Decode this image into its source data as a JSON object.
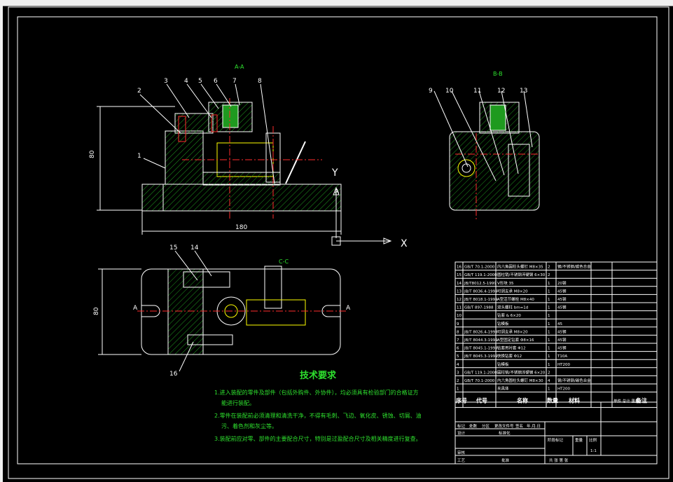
{
  "drawing": {
    "balloons": [
      "1",
      "2",
      "3",
      "4",
      "5",
      "6",
      "7",
      "8",
      "9",
      "10",
      "11",
      "12",
      "13",
      "14",
      "15",
      "16"
    ],
    "section_labels": {
      "aa": "A-A",
      "bb": "B-B",
      "cc": "C-C",
      "a": "A",
      "b": "B"
    },
    "axis_labels": {
      "y": "Y",
      "x": "X"
    },
    "dimensions": {
      "height1": "80",
      "width1": "180",
      "height2": "80"
    }
  },
  "tech": {
    "title": "技术要求",
    "lines": [
      "1.进入装配的零件及部件（包括外购件、外协件），均必须具有检验部门的合格证方",
      "能进行装配。",
      "2.零件在装配前必须清理和清洗干净，不得有毛刺、飞边、氧化皮、锈蚀、切屑、油",
      "污、着色剂和灰尘等。",
      "3.装配前应对零、部件的主要配合尺寸，特别是过盈配合尺寸及相关精度进行复查。"
    ]
  },
  "bom": {
    "rows": [
      [
        "16",
        "GB/T 70.1-2000",
        "内六角圆柱头螺钉 M8×35",
        "2",
        "钢/不锈钢/碳色合金",
        ""
      ],
      [
        "15",
        "GB/T 119.1-2000",
        "圆柱销/不锈钢淬硬钢 6×30",
        "2",
        "",
        ""
      ],
      [
        "14",
        "JB/T8012.5-1999",
        "V形块 35",
        "1",
        "20钢",
        ""
      ],
      [
        "13",
        "JB/T 8036.4-1999",
        "可调支承 M8×20",
        "1",
        "45钢",
        ""
      ],
      [
        "12",
        "JB/T 8018.1-1999",
        "A型活节螺栓 M8×40",
        "1",
        "45钢",
        ""
      ],
      [
        "11",
        "GB/T 897-1988",
        "双头螺柱 bm=1d",
        "1",
        "45钢",
        ""
      ],
      [
        "10",
        "",
        "钻套 & 6×20",
        "1",
        "",
        ""
      ],
      [
        "9",
        "",
        "钻模板",
        "1",
        "45",
        ""
      ],
      [
        "8",
        "JB/T 8026.4-1999",
        "可调支承 M8×20",
        "1",
        "45钢",
        ""
      ],
      [
        "7",
        "JB/T 8044.3-1999",
        "A型固定钻套 Φ8×16",
        "1",
        "45钢",
        ""
      ],
      [
        "6",
        "JB/T 8045.1-1999",
        "钻套用衬套 Φ12",
        "1",
        "45钢",
        ""
      ],
      [
        "5",
        "JB/T 8045.3-1999",
        "快换钻套 Φ12",
        "1",
        "T10A",
        ""
      ],
      [
        "4",
        "",
        "钻模板",
        "1",
        "HT200",
        ""
      ],
      [
        "3",
        "GB/T 119.1-2000",
        "圆柱销/不锈钢淬硬钢 6×20",
        "2",
        "",
        ""
      ],
      [
        "2",
        "GB/T 70.1-2000",
        "内六角圆柱头螺钉 M8×30",
        "4",
        "钢/不锈钢/碳色合金",
        ""
      ],
      [
        "1",
        "",
        "夹具体",
        "1",
        "HT200",
        ""
      ]
    ],
    "header": {
      "seq": "序号",
      "code": "代号",
      "name": "名称",
      "qty": "数量",
      "material": "材料",
      "weight": "单件 总计 重量",
      "remark": "备注"
    }
  },
  "title_block": {
    "row1": [
      "标记",
      "处数",
      "分区",
      "更改文件号",
      "签名",
      "年.月.日"
    ],
    "design": "设计",
    "standard": "标准化",
    "stage": "阶段标记",
    "weight": "重量",
    "scale": "比例",
    "scale_value": "1:1",
    "review": "审核",
    "process": "工艺",
    "approve": "批准",
    "sheets": "共   张   第   张"
  },
  "colors": {
    "bg": "#000000",
    "line": "#ffffff",
    "hatch": "#1f9a1f",
    "green": "#2ee02e",
    "red": "#ff2b2b",
    "yellow": "#ffff00",
    "magenta": "#ff3cff"
  }
}
